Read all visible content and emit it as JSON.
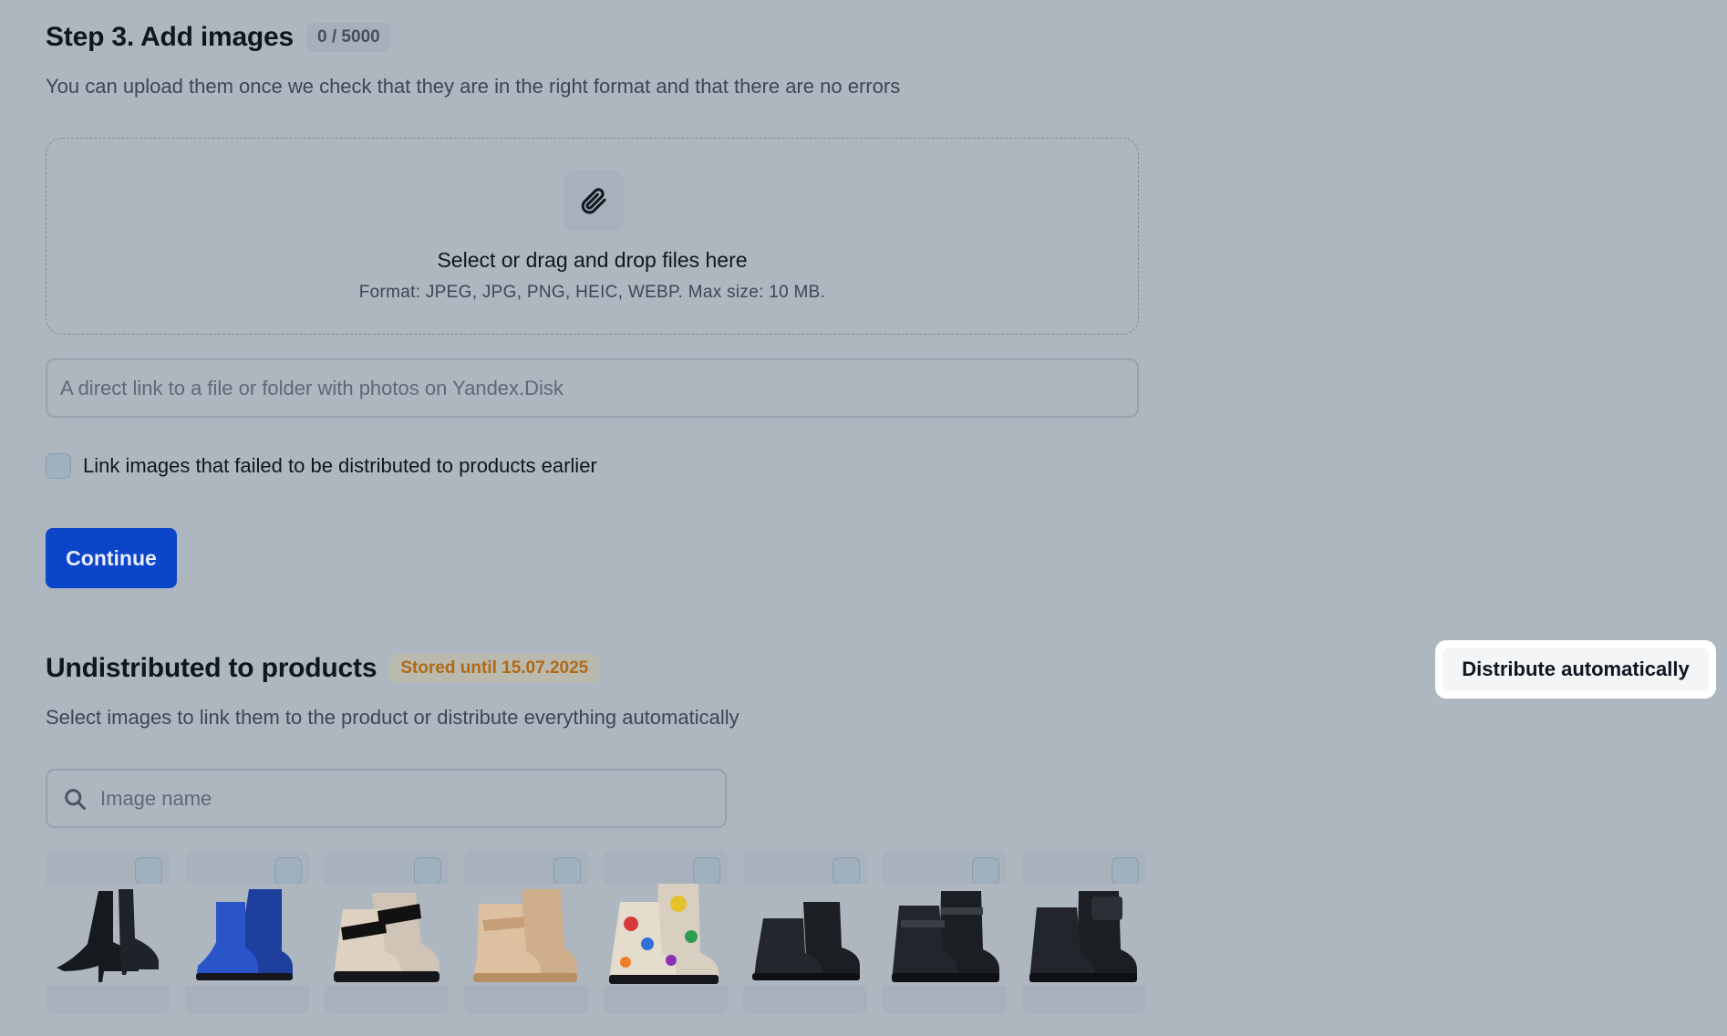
{
  "step3": {
    "title": "Step 3. Add images",
    "counter": "0 / 5000",
    "subtitle": "You can upload them once we check that they are in the right format and that there are no errors"
  },
  "dropzone": {
    "icon": "paperclip-icon",
    "title": "Select or drag and drop files here",
    "format": "Format: JPEG, JPG, PNG, HEIC, WEBP. Max size: 10 MB."
  },
  "link_input": {
    "value": "",
    "placeholder": "A direct link to a file or folder with photos on Yandex.Disk"
  },
  "link_failed": {
    "checked": false,
    "label": "Link images that failed to be distributed to products earlier"
  },
  "continue_label": "Continue",
  "undistributed": {
    "title": "Undistributed to products",
    "badge": "Stored until 15.07.2025",
    "subtitle": "Select images to link them to the product or distribute everything automatically",
    "distribute_label": "Distribute automatically"
  },
  "search": {
    "icon": "search-icon",
    "value": "",
    "placeholder": "Image name"
  },
  "images": [
    {
      "item": "black-heeled-ankle-boot",
      "checked": false
    },
    {
      "item": "blue-metallic-lace-up-boot",
      "checked": false
    },
    {
      "item": "beige-black-velcro-boot",
      "checked": false
    },
    {
      "item": "gold-velcro-boot",
      "checked": false
    },
    {
      "item": "graffiti-print-lace-up-boot",
      "checked": false
    },
    {
      "item": "black-chelsea-style-boot",
      "checked": false
    },
    {
      "item": "black-buckle-strap-boot",
      "checked": false
    },
    {
      "item": "black-boot-with-pouch",
      "checked": false
    }
  ],
  "colors": {
    "background": "#aeb7c0",
    "primary_button": "#0c45c9",
    "stored_badge_text": "#b06a17",
    "stored_badge_bg": "#b9b9ae"
  }
}
